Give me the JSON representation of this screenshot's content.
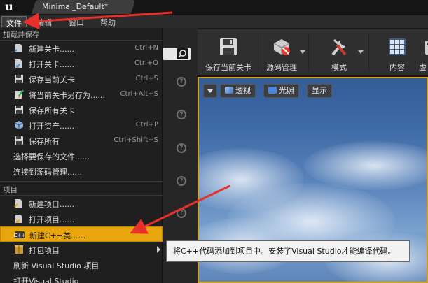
{
  "window": {
    "tab_title": "Minimal_Default*",
    "logo_text": "u"
  },
  "menubar": {
    "items": [
      {
        "label": "文件",
        "active": true
      },
      {
        "label": "编辑"
      },
      {
        "label": "窗口"
      },
      {
        "label": "帮助"
      }
    ]
  },
  "file_menu": {
    "section1_label": "加载并保存",
    "section1_items": [
      {
        "label": "新建关卡......",
        "shortcut": "Ctrl+N",
        "icon": "new-level-icon"
      },
      {
        "label": "打开关卡......",
        "shortcut": "Ctrl+O",
        "icon": "open-level-icon"
      },
      {
        "label": "保存当前关卡",
        "shortcut": "Ctrl+S",
        "icon": "save-icon"
      },
      {
        "label": "将当前关卡另存为......",
        "shortcut": "Ctrl+Alt+S",
        "icon": "save-as-icon"
      },
      {
        "label": "保存所有关卡",
        "shortcut": "",
        "icon": "save-all-levels-icon"
      },
      {
        "label": "打开资产......",
        "shortcut": "Ctrl+P",
        "icon": "open-asset-icon"
      },
      {
        "label": "保存所有",
        "shortcut": "Ctrl+Shift+S",
        "icon": "save-all-icon"
      },
      {
        "label": "选择要保存的文件......",
        "shortcut": ""
      },
      {
        "label": "连接到源码管理......",
        "shortcut": ""
      }
    ],
    "section2_label": "项目",
    "section2_items": [
      {
        "label": "新建项目......",
        "icon": "new-project-icon"
      },
      {
        "label": "打开项目......",
        "icon": "open-project-icon"
      },
      {
        "label": "新建C++类......",
        "icon": "new-cpp-class-icon",
        "highlighted": true
      },
      {
        "label": "打包项目",
        "icon": "package-project-icon",
        "submenu": true
      },
      {
        "label": "刷新 Visual Studio 项目"
      },
      {
        "label": "打开Visual Studio"
      }
    ]
  },
  "toolbar": {
    "buttons": [
      {
        "label": "保存当前关卡",
        "icon": "save-floppy-icon"
      },
      {
        "label": "源码管理",
        "icon": "source-control-icon"
      },
      {
        "label": "模式",
        "icon": "modes-tools-icon"
      },
      {
        "label": "内容",
        "icon": "content-grid-icon"
      },
      {
        "label": "虚",
        "icon": "marketplace-icon"
      }
    ]
  },
  "viewport": {
    "buttons": {
      "perspective": "透视",
      "lit": "光照",
      "show": "显示"
    }
  },
  "tooltip": {
    "text": "将C++代码添加到项目中。安装了Visual Studio才能编译代码。"
  },
  "colors": {
    "highlight": "#e8a60c",
    "arrow": "#e8302a",
    "viewport_border": "#d4a017"
  }
}
